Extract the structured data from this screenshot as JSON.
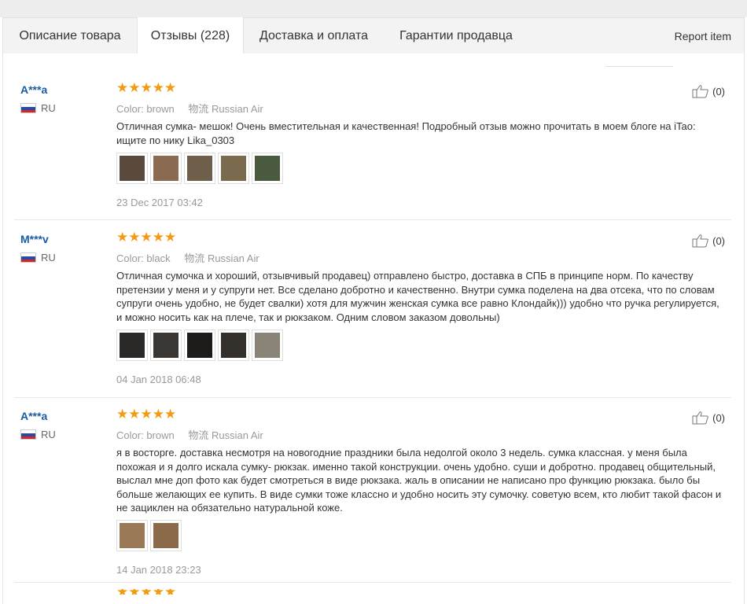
{
  "tabs": [
    {
      "label": "Описание товара"
    },
    {
      "label": "Отзывы (228)"
    },
    {
      "label": "Доставка и оплата"
    },
    {
      "label": "Гарантии продавца"
    }
  ],
  "report_label": "Report item",
  "labels": {
    "color": "Color:",
    "logistics": "物流"
  },
  "reviews": [
    {
      "user": "A***a",
      "country": "RU",
      "stars": "★★★★★",
      "color": "brown",
      "logistics": "Russian Air",
      "likes": "(0)",
      "text": "Отличная сумка- мешок! Очень вместительная и качественная! Подробный отзыв можно прочитать в моем блоге на iTao: ищите по нику Lika_0303",
      "date": "23 Dec 2017 03:42",
      "photo_colors": [
        "#5a4a3e",
        "#8a6a50",
        "#6e5e4a",
        "#7a6a4e",
        "#4a5a3e"
      ]
    },
    {
      "user": "M***v",
      "country": "RU",
      "stars": "★★★★★",
      "color": "black",
      "logistics": "Russian Air",
      "likes": "(0)",
      "text": "Отличная сумочка и хороший, отзывчивый продавец) отправлено быстро, доставка в СПБ в принципе норм. По качеству претензии у меня и у супруги нет. Все сделано добротно и качественно. Внутри сумка поделена на два отсека, что по словам супруги очень удобно, не будет свалки) хотя для мужчин женская сумка все равно Клондайк))) удобно что ручка регулируется, и можно носить как на плече, так и рюкзаком. Одним словом заказом довольны)",
      "date": "04 Jan 2018 06:48",
      "photo_colors": [
        "#2a2826",
        "#3a3634",
        "#1e1c1a",
        "#34302c",
        "#8a8478"
      ]
    },
    {
      "user": "A***a",
      "country": "RU",
      "stars": "★★★★★",
      "color": "brown",
      "logistics": "Russian Air",
      "likes": "(0)",
      "text": "я в восторге. доставка несмотря на новогодние праздники была недолгой около 3 недель. сумка классная. у меня была похожая и я долго искала сумку- рюкзак. именно такой конструкции. очень удобно. суши и добротно. продавец общительный, выслал мне доп фото как будет смотреться в виде рюкзака. жаль в описании не написано про функцию рюкзака. было бы больше желающих ее купить. В виде сумки тоже классно и удобно носить эту сумочку. советую всем, кто любит такой фасон и не зациклен на обязательно натуральной коже.",
      "date": "14 Jan 2018 23:23",
      "photo_colors": [
        "#9a7a56",
        "#8a6a48"
      ]
    }
  ]
}
